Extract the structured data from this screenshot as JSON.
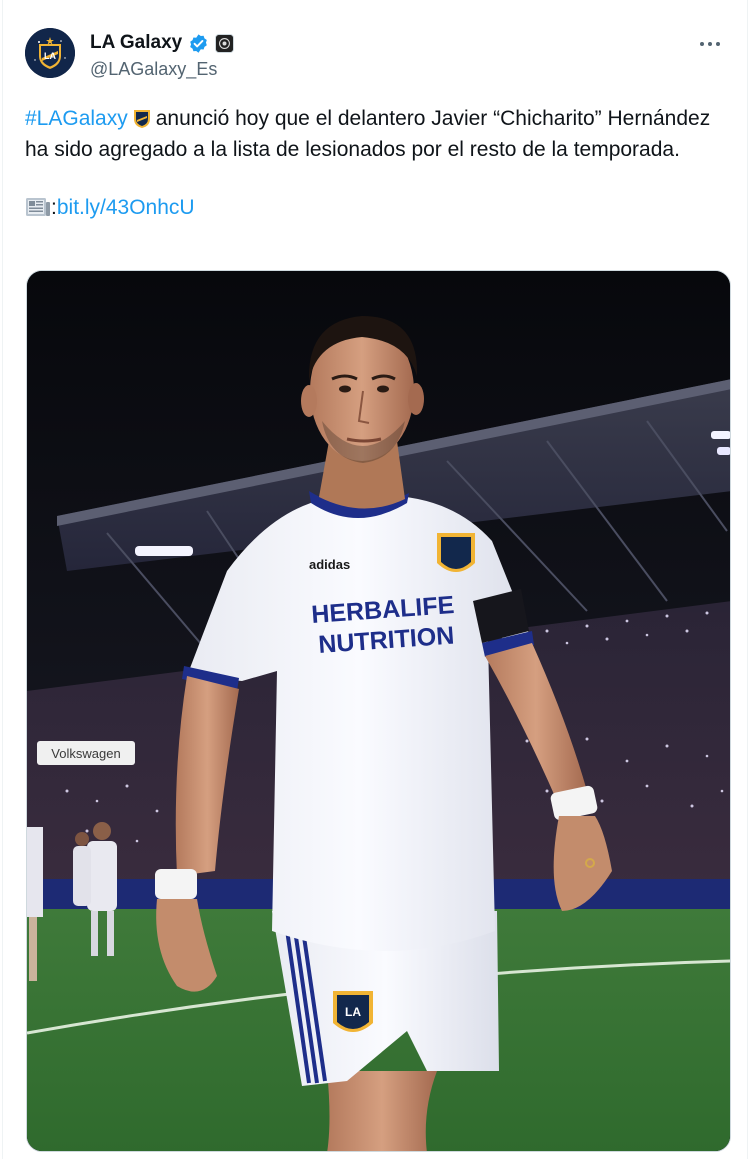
{
  "account": {
    "display_name": "LA Galaxy",
    "handle": "@LAGalaxy_Es",
    "avatar_icon": "la-galaxy-crest-icon",
    "verified": true,
    "affiliation_icon": "affiliate-badge-icon"
  },
  "tweet": {
    "hashtag": "#LAGalaxy",
    "body": "anunció hoy que el delantero Javier “Chicharito” Hernández ha sido agregado a la lista de lesionados por el resto de la temporada.",
    "link_prefix": ":",
    "link_text": "bit.ly/43OnhcU",
    "hashtag_icon": "la-galaxy-crest-icon",
    "link_icon": "newspaper-icon"
  },
  "media": {
    "description_icon": "player-photo",
    "jersey_sponsor_line1": "HERBALIFE",
    "jersey_sponsor_line2": "NUTRITION",
    "jersey_brand": "adidas",
    "stadium_sign": "Volkswagen",
    "crest_text": "LA"
  },
  "colors": {
    "link": "#1d9bf0",
    "text": "#0f1419",
    "muted": "#536471",
    "galaxy_navy": "#12284c",
    "galaxy_gold": "#f1b434"
  }
}
